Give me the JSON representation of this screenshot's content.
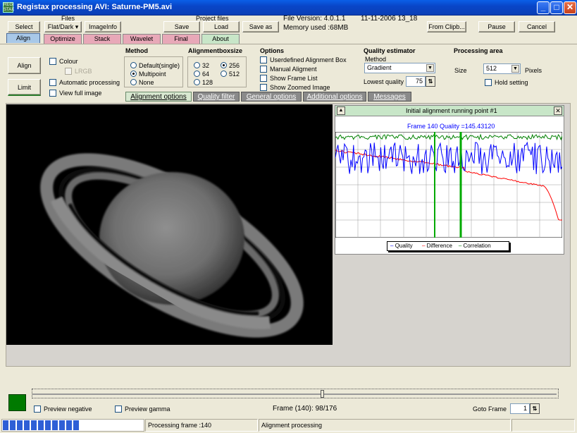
{
  "window": {
    "title": "Registax processing AVI: Saturne-PM5.avi",
    "icon_label": "REGI STAX",
    "controls": [
      "_",
      "□",
      "✕"
    ]
  },
  "toolbar": {
    "select": "Select",
    "files_label": "Files",
    "flatdark": "Flat/Dark ▾",
    "imageinfo": "ImageInfo",
    "project_files_label": "Project files",
    "save": "Save",
    "load": "Load",
    "save_as": "Save as",
    "file_version": "File Version: 4.0.1.1",
    "build_date": "11-11-2006 13_18",
    "memory": "Memory used :68MB",
    "from_clip": "From Clipb...",
    "pause": "Pause",
    "cancel": "Cancel"
  },
  "main_tabs": [
    "Align",
    "Optimize",
    "Stack",
    "Wavelet",
    "Final",
    "About"
  ],
  "left_panel": {
    "align_button": "Align",
    "limit_button": "Limit",
    "colour": "Colour",
    "lrgb": "LRGB",
    "auto_processing": "Automatic processing",
    "view_full_image": "View full image"
  },
  "method": {
    "label": "Method",
    "options": [
      "Default(single)",
      "Multipoint",
      "None"
    ],
    "selected": "Multipoint"
  },
  "boxsize": {
    "label": "Alignmentboxsize",
    "options": [
      "32",
      "256",
      "64",
      "512",
      "128"
    ],
    "selected": "256"
  },
  "options": {
    "label": "Options",
    "items": [
      "Userdefined Alignment Box",
      "Manual Aligment",
      "Show Frame List",
      "Show Zoomed Image"
    ]
  },
  "quality": {
    "label": "Quality estimator",
    "method_label": "Method",
    "method_value": "Gradient",
    "lowest_label": "Lowest quality",
    "lowest_value": "75"
  },
  "processing_area": {
    "label": "Processing area",
    "size_label": "Size",
    "size_value": "512",
    "pixels_label": "Pixels",
    "hold": "Hold setting"
  },
  "sub_tabs": [
    "Alignment  options",
    "Quality  filter",
    "General options",
    "Additional options",
    "Messages"
  ],
  "graph": {
    "header": "Initial alignment running point #1",
    "frame_label": "Frame 140 Quality =145.43120",
    "legend": [
      "Quality",
      "Difference",
      "Correlation"
    ],
    "colors": {
      "quality": "#0000ff",
      "difference": "#ff0000",
      "correlation": "#008000",
      "marker": "#00aa00"
    }
  },
  "bottom": {
    "preview_negative": "Preview negative",
    "preview_gamma": "Preview gamma",
    "frame_info": "Frame (140): 98/176",
    "goto_frame_label": "Goto Frame",
    "goto_frame_value": "1",
    "progress_fraction": 0.55
  },
  "status": {
    "processing_frame": "Processing frame :140",
    "stage": "Alignment processing"
  }
}
